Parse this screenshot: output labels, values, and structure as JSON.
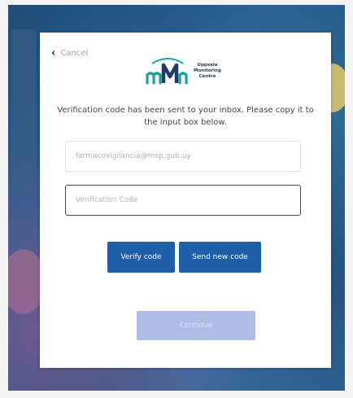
{
  "cancel": {
    "label": "Cancel"
  },
  "logo": {
    "line1": "Uppsala",
    "line2": "Monitoring",
    "line3": "Centre"
  },
  "message": "Verification code has been sent to your inbox. Please copy it to the input box below.",
  "email_field": {
    "value": "farmacovigilancia@msp.gub.uy"
  },
  "code_field": {
    "placeholder": "Verification Code"
  },
  "buttons": {
    "verify": "Verify code",
    "send": "Send new code",
    "continue": "Continue"
  },
  "colors": {
    "primary": "#1f5fa8",
    "disabled": "#aebce6",
    "logo_teal": "#1aa39a",
    "logo_navy": "#1e3a66"
  }
}
